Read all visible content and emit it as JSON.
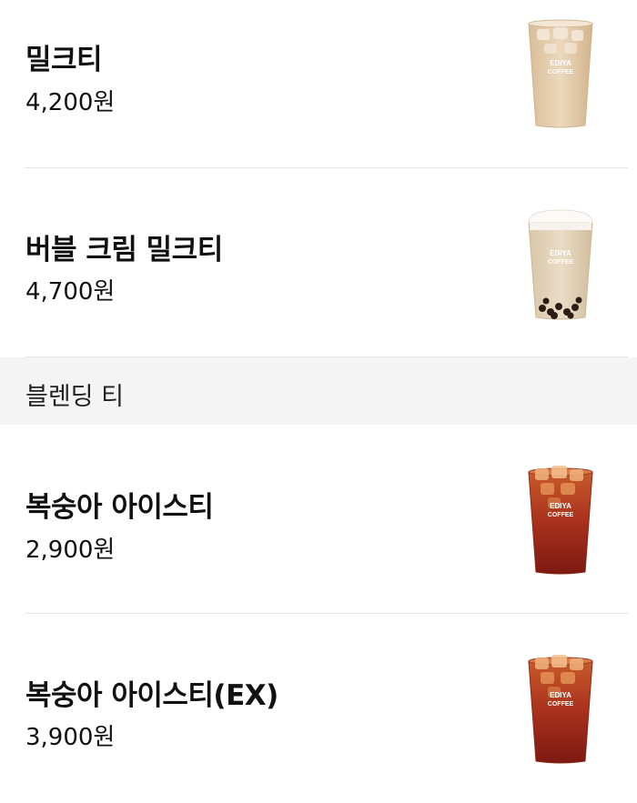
{
  "menu": {
    "items": [
      {
        "name": "밀크티",
        "price": "4,200원",
        "icon": "milk-tea-cup-icon",
        "cup_text": "EDIYA COFFEE"
      },
      {
        "name": "버블 크림 밀크티",
        "price": "4,700원",
        "icon": "bubble-milk-tea-cup-icon",
        "cup_text": "EDIYA COFFEE"
      }
    ],
    "section": {
      "title": "블렌딩 티"
    },
    "section_items": [
      {
        "name": "복숭아 아이스티",
        "price": "2,900원",
        "icon": "peach-iced-tea-cup-icon",
        "cup_text": "EDIYA COFFEE"
      },
      {
        "name": "복숭아 아이스티(EX)",
        "price": "3,900원",
        "icon": "peach-iced-tea-ex-cup-icon",
        "cup_text": "EDIYA COFFEE"
      }
    ]
  },
  "colors": {
    "background": "#ffffff",
    "divider": "#e6e6e6",
    "section_background": "#f4f4f4",
    "text": "#111111",
    "milk_tea": "#e3c9a6",
    "iced_tea": "#9e2515"
  }
}
